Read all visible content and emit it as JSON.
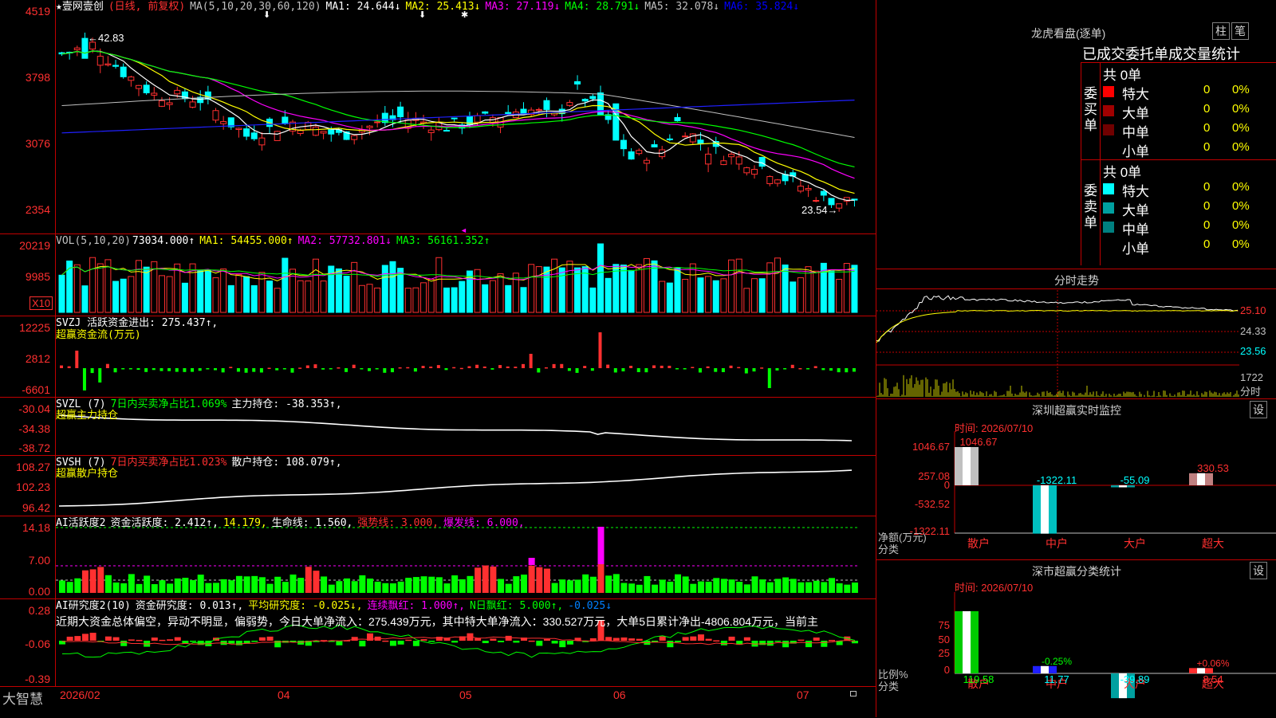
{
  "stock": {
    "star": "★",
    "name": "壹网壹创",
    "period": "(日线, 前复权)"
  },
  "main_legend": {
    "ma_params": "MA(5,10,20,30,60,120)",
    "items": [
      {
        "label": "MA1:",
        "value": "24.644↓",
        "color": "#ffffff"
      },
      {
        "label": "MA2:",
        "value": "25.413↓",
        "color": "#ffff00"
      },
      {
        "label": "MA3:",
        "value": "27.119↓",
        "color": "#ff00ff"
      },
      {
        "label": "MA4:",
        "value": "28.791↓",
        "color": "#00ff00"
      },
      {
        "label": "MA5:",
        "value": "32.078↓",
        "color": "#c0c0c0"
      },
      {
        "label": "MA6:",
        "value": "35.824↓",
        "color": "#0000ff"
      }
    ]
  },
  "main_axis": [
    "4519",
    "3798",
    "3076",
    "2354"
  ],
  "price_marks": {
    "high": "←42.83",
    "low": "23.54→"
  },
  "vol_legend": {
    "params": "VOL(5,10,20)",
    "value": "73034.000↑",
    "ma1": "MA1: 54455.000↑",
    "ma2": "MA2: 57732.801↓",
    "ma3": "MA3: 56161.352↑"
  },
  "vol_axis": [
    "20219",
    "9985"
  ],
  "vol_unit": "X10",
  "svzj": {
    "legend_a": "SVZJ  活跃资金进出: 275.437↑,",
    "legend_b": "超赢资金流(万元)",
    "axis": [
      "12225",
      "2812",
      "-6601"
    ]
  },
  "svzl": {
    "legend_a": "SVZL (7)",
    "legend_b": "7日内买卖净占比1.069%",
    "legend_c": "主力持仓: -38.353↑,",
    "legend_d": "超赢主力持仓",
    "axis": [
      "-30.04",
      "-34.38",
      "-38.72"
    ]
  },
  "svsh": {
    "legend_a": "SVSH (7)",
    "legend_b": "7日内买卖净占比1.023%",
    "legend_c": "散户持仓: 108.079↑,",
    "legend_d": "超赢散户持仓",
    "axis": [
      "108.27",
      "102.23",
      "96.42"
    ]
  },
  "ai_active": {
    "l1": "AI活跃度2",
    "l2": "资金活跃度: 2.412↑,",
    "l3": "14.179,",
    "l4": "生命线: 1.560,",
    "l5": "强势线: 3.000,",
    "l6": "爆发线: 6.000,",
    "axis": [
      "14.18",
      "7.00",
      "0.00"
    ]
  },
  "ai_research": {
    "l1": "AI研究度2(10)",
    "l2": "资金研究度: 0.013↑,",
    "l3": "平均研究度: -0.025↓,",
    "l4": "连续飘红: 1.000↑,",
    "l5": "N日飘红: 5.000↑,",
    "l6": "-0.025↓",
    "note": "近期大资金总体偏空，异动不明显，偏弱势，今日大单净流入：275.439万元，其中特大单净流入：330.527万元，大单5日累计净出-4806.804万元，当前主",
    "axis": [
      "0.28",
      "-0.06",
      "-0.39"
    ]
  },
  "bottom": {
    "brand": "大智慧",
    "dates": [
      "2026/02",
      "04",
      "05",
      "06",
      "07"
    ]
  },
  "lhb": {
    "title": "龙虎看盘(逐单)",
    "btn1": "柱",
    "btn2": "笔",
    "subtitle": "已成交委托单成交量统计",
    "buy_side": "委买单",
    "sell_side": "委卖单",
    "buy_total": "共 0单",
    "sell_total": "共 0单",
    "buy_rows": [
      {
        "label": "特大",
        "n": "0",
        "p": "0%",
        "color": "#ff0000"
      },
      {
        "label": "大单",
        "n": "0",
        "p": "0%",
        "color": "#a00000"
      },
      {
        "label": "中单",
        "n": "0",
        "p": "0%",
        "color": "#700000"
      },
      {
        "label": "小单",
        "n": "0",
        "p": "0%",
        "color": "#000000"
      }
    ],
    "sell_rows": [
      {
        "label": "特大",
        "n": "0",
        "p": "0%",
        "color": "#00ffff"
      },
      {
        "label": "大单",
        "n": "0",
        "p": "0%",
        "color": "#00a0a0"
      },
      {
        "label": "中单",
        "n": "0",
        "p": "0%",
        "color": "#008080"
      },
      {
        "label": "小单",
        "n": "0",
        "p": "0%",
        "color": "#000000"
      }
    ]
  },
  "intraday": {
    "title": "分时走势",
    "axis": [
      "25.10",
      "24.33",
      "23.56"
    ],
    "vol": "1722",
    "unit": "分时"
  },
  "sz_monitor": {
    "title": "深圳超赢实时监控",
    "btn": "设",
    "time": "时间: 2026/07/10",
    "axis": [
      "1046.67",
      "257.08",
      "0",
      "-532.52",
      "-1322.11"
    ],
    "ylabel": "净额(万元)",
    "xlabel": "分类",
    "cats": [
      "散户",
      "中户",
      "大户",
      "超大"
    ],
    "vals": [
      "1046.67",
      "-1322.11",
      "-55.09",
      "330.53"
    ],
    "chart_data": {
      "type": "bar",
      "categories": [
        "散户",
        "中户",
        "大户",
        "超大"
      ],
      "values": [
        1046.67,
        -1322.11,
        -55.09,
        330.53
      ],
      "ylabel": "净额(万元)",
      "xlabel": "分类"
    }
  },
  "sz_class": {
    "title": "深市超赢分类统计",
    "btn": "设",
    "time": "时间: 2026/07/10",
    "axis": [
      "75",
      "50",
      "25",
      "0"
    ],
    "ylabel": "比例%",
    "xlabel": "分类",
    "cats": [
      "散户",
      "中户",
      "大户",
      "超大"
    ],
    "labels_top": [
      "",
      "-0.25%",
      "",
      "+0.06%"
    ],
    "vals": [
      "119.58",
      "11.77",
      "-39.89",
      "8.54"
    ],
    "chart_data": {
      "type": "bar",
      "categories": [
        "散户",
        "中户",
        "大户",
        "超大"
      ],
      "values": [
        119.58,
        11.77,
        -39.89,
        8.54
      ],
      "ylabel": "比例%",
      "xlabel": "分类"
    }
  }
}
